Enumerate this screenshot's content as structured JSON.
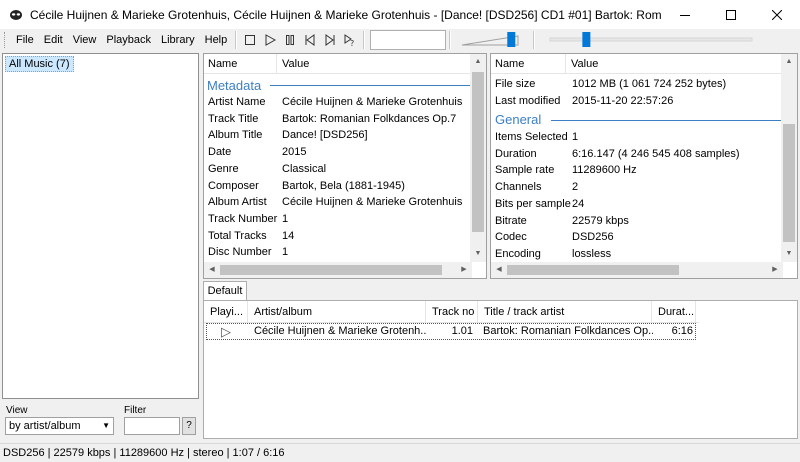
{
  "window": {
    "title": "Cécile Huijnen & Marieke Grotenhuis, Cécile Huijnen & Marieke Grotenhuis - [Dance! [DSD256] CD1 #01] Bartok: Romanian Folkdances Op...."
  },
  "menu": [
    "File",
    "Edit",
    "View",
    "Playback",
    "Library",
    "Help"
  ],
  "library": {
    "tree_item": "All Music (7)",
    "view_label": "View",
    "view_value": "by artist/album",
    "filter_label": "Filter",
    "help_button": "?"
  },
  "metadata_panel": {
    "col_name": "Name",
    "col_value": "Value",
    "section": "Metadata",
    "rows": [
      {
        "k": "Artist Name",
        "v": "Cécile Huijnen & Marieke Grotenhuis"
      },
      {
        "k": "Track Title",
        "v": "Bartok: Romanian Folkdances Op.7"
      },
      {
        "k": "Album Title",
        "v": "Dance! [DSD256]"
      },
      {
        "k": "Date",
        "v": "2015"
      },
      {
        "k": "Genre",
        "v": "Classical"
      },
      {
        "k": "Composer",
        "v": "Bartok, Bela (1881-1945)"
      },
      {
        "k": "Album Artist",
        "v": "Cécile Huijnen & Marieke Grotenhuis"
      },
      {
        "k": "Track Number",
        "v": "1"
      },
      {
        "k": "Total Tracks",
        "v": "14"
      },
      {
        "k": "Disc Number",
        "v": "1"
      }
    ]
  },
  "info_panel": {
    "col_name": "Name",
    "col_value": "Value",
    "top_rows": [
      {
        "k": "File size",
        "v": "1012 MB (1 061 724 252 bytes)"
      },
      {
        "k": "Last modified",
        "v": "2015-11-20 22:57:26"
      }
    ],
    "section": "General",
    "rows": [
      {
        "k": "Items Selected",
        "v": "1"
      },
      {
        "k": "Duration",
        "v": "6:16.147 (4 246 545 408 samples)"
      },
      {
        "k": "Sample rate",
        "v": "11289600 Hz"
      },
      {
        "k": "Channels",
        "v": "2"
      },
      {
        "k": "Bits per sample",
        "v": "24"
      },
      {
        "k": "Bitrate",
        "v": "22579 kbps"
      },
      {
        "k": "Codec",
        "v": "DSD256"
      },
      {
        "k": "Encoding",
        "v": "lossless"
      }
    ]
  },
  "playlist": {
    "tab": "Default",
    "columns": [
      "Playi...",
      "Artist/album",
      "Track no",
      "Title / track artist",
      "Durat..."
    ],
    "rows": [
      {
        "playing": "▷",
        "artist_album": "Cécile Huijnen & Marieke Grotenh...",
        "track_no": "1.01",
        "title": "Bartok: Romanian Folkdances Op....",
        "duration": "6:16"
      }
    ]
  },
  "controls": {
    "volume_level": 0.88,
    "seek_level": 0.18
  },
  "status": "DSD256 | 22579 kbps | 11289600 Hz | stereo | 1:07 / 6:16"
}
